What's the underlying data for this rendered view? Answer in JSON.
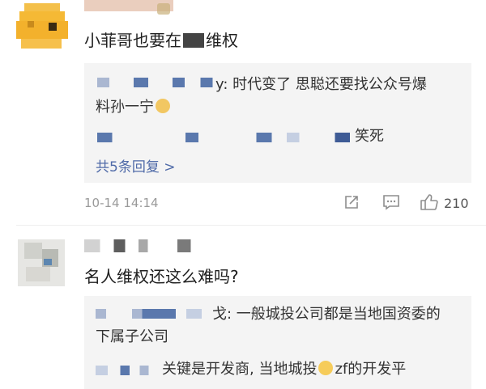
{
  "comments": [
    {
      "text": "小菲哥也要在",
      "text_suffix": "维权",
      "reply_preview": [
        {
          "line1": "y: 时代变了 思聪还要找公众号爆",
          "line2": "料孙一宁"
        },
        {
          "text": "笑死"
        }
      ],
      "more_replies": "共5条回复 >",
      "timestamp": "10-14 14:14",
      "like_count": "210"
    },
    {
      "text": "名人维权还这么难吗?",
      "reply_preview": [
        {
          "line1": "戈: 一般城投公司都是当地国资委的",
          "line2": "下属子公司"
        },
        {
          "part1": "关键是开发商, 当地城投",
          "part2": "zf的开发平"
        }
      ]
    }
  ],
  "icons": [
    "share-icon",
    "comment-icon",
    "like-icon"
  ]
}
